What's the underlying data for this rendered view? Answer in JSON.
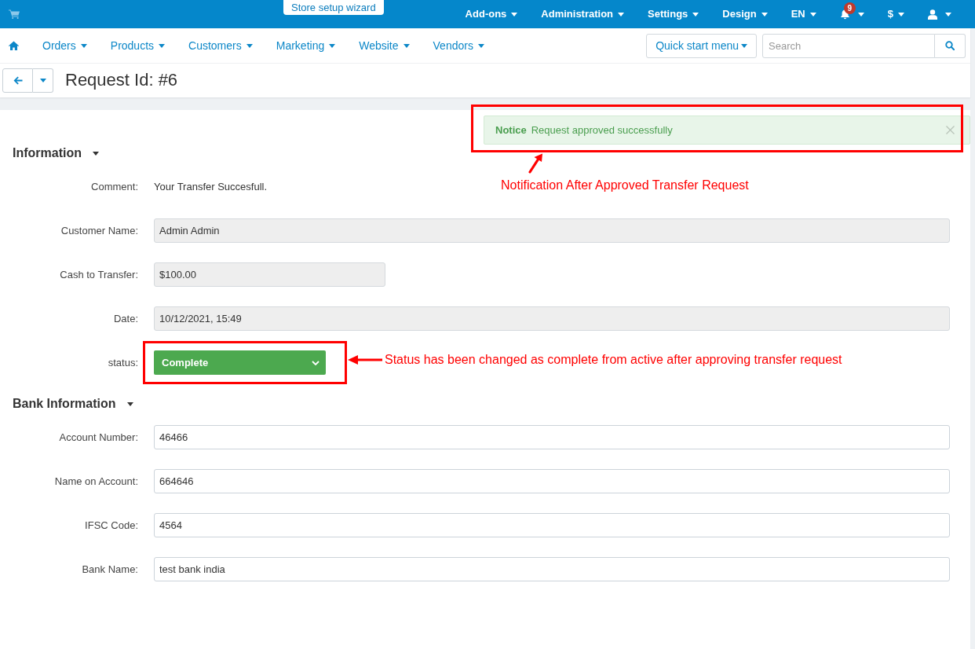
{
  "top_bar": {
    "wizard_button": "Store setup wizard",
    "menus": [
      {
        "kind": "menu",
        "label": "Add-ons"
      },
      {
        "kind": "menu",
        "label": "Administration"
      },
      {
        "kind": "menu",
        "label": "Settings"
      },
      {
        "kind": "menu",
        "label": "Design"
      },
      {
        "kind": "menu",
        "label": "EN"
      },
      {
        "kind": "notifications",
        "badge": "9"
      },
      {
        "kind": "menu",
        "label": "$"
      },
      {
        "kind": "user"
      }
    ]
  },
  "main_nav": {
    "items": [
      {
        "label": "Orders"
      },
      {
        "label": "Products"
      },
      {
        "label": "Customers"
      },
      {
        "label": "Marketing"
      },
      {
        "label": "Website"
      },
      {
        "label": "Vendors"
      }
    ],
    "quick_start_button": "Quick start menu",
    "search": {
      "placeholder": "Search"
    }
  },
  "page_title": "Request Id: #6",
  "notice": {
    "title": "Notice",
    "message": "Request approved successfully"
  },
  "sections": [
    {
      "title": "Information",
      "fields": [
        {
          "kind": "text",
          "label": "Comment:",
          "value": "Your Transfer Succesfull."
        },
        {
          "kind": "input",
          "label": "Customer Name:",
          "value": "Admin Admin",
          "disabled": true
        },
        {
          "kind": "amount",
          "label": "Cash to Transfer:",
          "value": "$100.00",
          "disabled": true
        },
        {
          "kind": "input",
          "label": "Date:",
          "value": "10/12/2021, 15:49",
          "disabled": true
        },
        {
          "kind": "select",
          "label": "status:",
          "value": "Complete",
          "color": "#4ca94f"
        }
      ]
    },
    {
      "title": "Bank Information",
      "fields": [
        {
          "kind": "input",
          "label": "Account Number:",
          "value": "46466",
          "disabled": false
        },
        {
          "kind": "input",
          "label": "Name on Account:",
          "value": "664646",
          "disabled": false
        },
        {
          "kind": "input",
          "label": "IFSC Code:",
          "value": "4564",
          "disabled": false
        },
        {
          "kind": "input",
          "label": "Bank Name:",
          "value": "test bank india",
          "disabled": false
        }
      ]
    }
  ],
  "annotations": [
    {
      "text": "Notification After Approved Transfer Request"
    },
    {
      "text": "Status has been changed as complete from active after approving transfer request"
    }
  ]
}
